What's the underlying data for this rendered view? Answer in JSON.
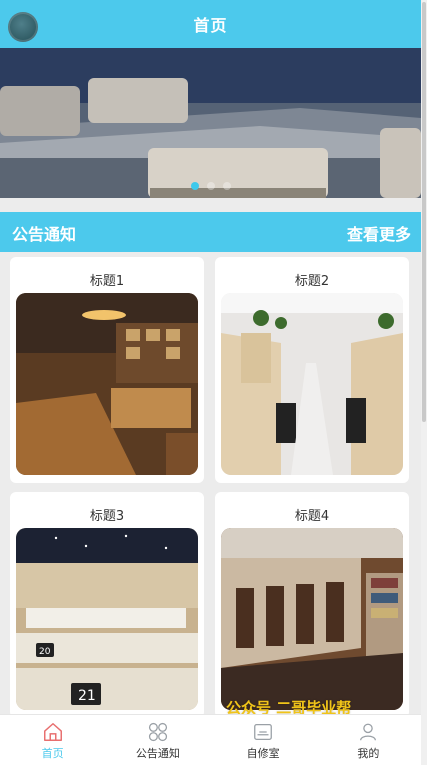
{
  "header": {
    "title": "首页"
  },
  "banner": {
    "dots": 3,
    "active_dot": 0
  },
  "notice": {
    "title": "公告通知",
    "more": "查看更多"
  },
  "cards": [
    {
      "title": "标题1"
    },
    {
      "title": "标题2"
    },
    {
      "title": "标题3"
    },
    {
      "title": "标题4"
    }
  ],
  "watermark": "公众号 二哥毕业帮",
  "tabbar": {
    "items": [
      {
        "label": "首页",
        "icon": "home-icon",
        "active": true
      },
      {
        "label": "公告通知",
        "icon": "grid-icon",
        "active": false
      },
      {
        "label": "自修室",
        "icon": "room-icon",
        "active": false
      },
      {
        "label": "我的",
        "icon": "user-icon",
        "active": false
      }
    ]
  },
  "colors": {
    "primary": "#4cc9ec",
    "accent": "#f0c419"
  }
}
